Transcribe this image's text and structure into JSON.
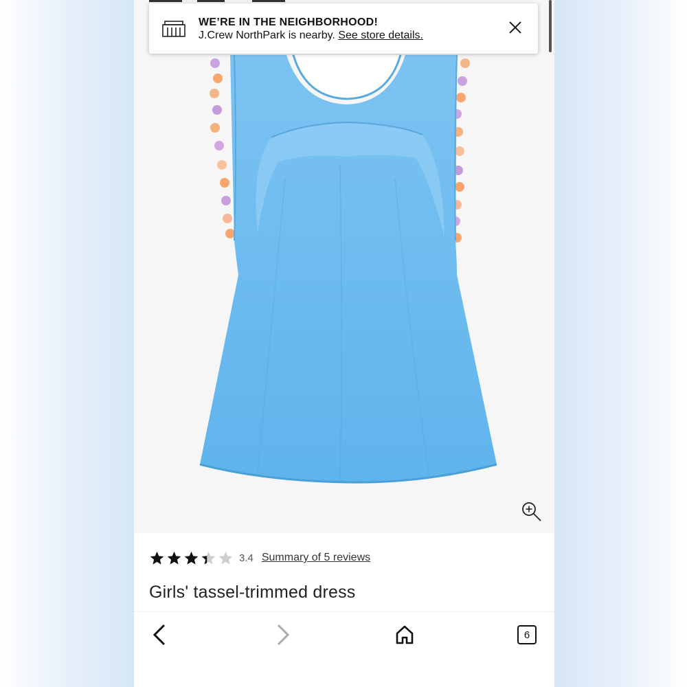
{
  "banner": {
    "title": "WE’RE IN THE NEIGHBORHOOD!",
    "text": "J.Crew NorthPark is nearby.",
    "link_label": "See store details.",
    "icon": "store-icon",
    "close_icon": "close-icon"
  },
  "product": {
    "rating_value": "3.4",
    "rating_stars": 3.4,
    "rating_max": 5,
    "reviews_link": "Summary of 5 reviews",
    "title": "Girls' tassel-trimmed dress",
    "dress_color": "#6fbdf0"
  },
  "hero": {
    "zoom_icon": "zoom-in-icon"
  },
  "toolbar": {
    "back_icon": "chevron-left-icon",
    "forward_icon": "chevron-right-icon",
    "home_icon": "home-icon",
    "tab_count": "6"
  }
}
